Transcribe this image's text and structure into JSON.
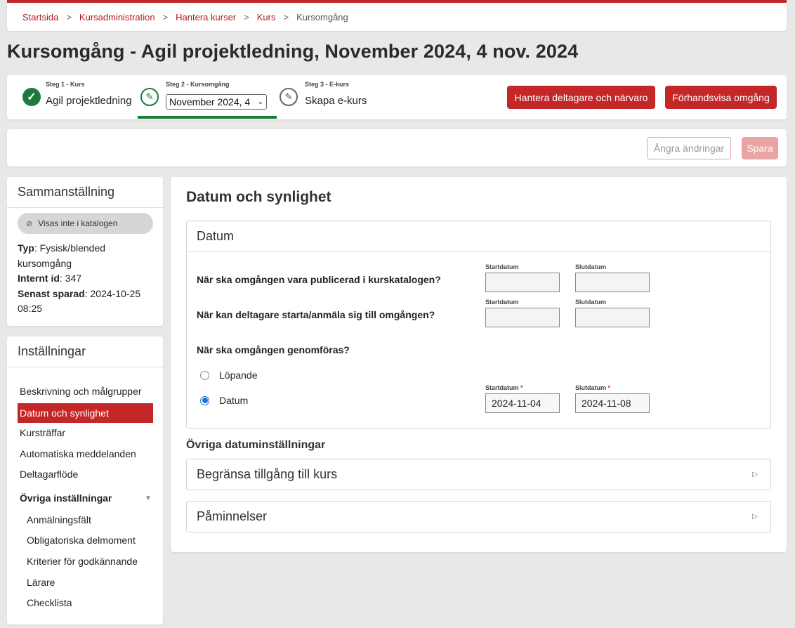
{
  "breadcrumb": [
    "Startsida",
    "Kursadministration",
    "Hantera kurser",
    "Kurs"
  ],
  "breadcrumb_current": "Kursomgång",
  "breadcrumb_separator": ">",
  "page_title": "Kursomgång - Agil projektledning, November 2024, 4 nov. 2024",
  "steps": {
    "step1_small": "Steg 1 - Kurs",
    "step1_label": "Agil projektledning",
    "step2_small": "Steg 2 - Kursomgång",
    "step2_select": "November 2024, 4",
    "step3_small": "Steg 3 - E-kurs",
    "step3_label": "Skapa e-kurs"
  },
  "header_buttons": {
    "manage": "Hantera deltagare och närvaro",
    "preview": "Förhandsvisa omgång"
  },
  "actions": {
    "undo": "Ångra ändringar",
    "save": "Spara"
  },
  "summary": {
    "title": "Sammanställning",
    "pill": "Visas inte i katalogen",
    "type_label": "Typ",
    "type_value": ": Fysisk/blended kursomgång",
    "id_label": "Internt id",
    "id_value": ": 347",
    "saved_label": "Senast sparad",
    "saved_value": ": 2024-10-25 08:25"
  },
  "settings": {
    "title": "Inställningar",
    "items": [
      "Beskrivning och målgrupper",
      "Datum och synlighet",
      "Kursträffar",
      "Automatiska meddelanden",
      "Deltagarflöde"
    ],
    "group": "Övriga inställningar",
    "sub_items": [
      "Anmälningsfält",
      "Obligatoriska delmoment",
      "Kriterier för godkännande",
      "Lärare",
      "Checklista"
    ]
  },
  "main": {
    "title": "Datum och synlighet",
    "panel_title": "Datum",
    "q1": "När ska omgången vara publicerad i kurskatalogen?",
    "q2": "När kan deltagare starta/anmäla sig till omgången?",
    "q3": "När ska omgången genomföras?",
    "start_label": "Startdatum",
    "end_label": "Slutdatum",
    "required_mark": "*",
    "radio_running": "Löpande",
    "radio_date": "Datum",
    "start_value": "2024-11-04",
    "end_value": "2024-11-08",
    "other_title": "Övriga datuminställningar",
    "acc1": "Begränsa tillgång till kurs",
    "acc2": "Påminnelser"
  }
}
